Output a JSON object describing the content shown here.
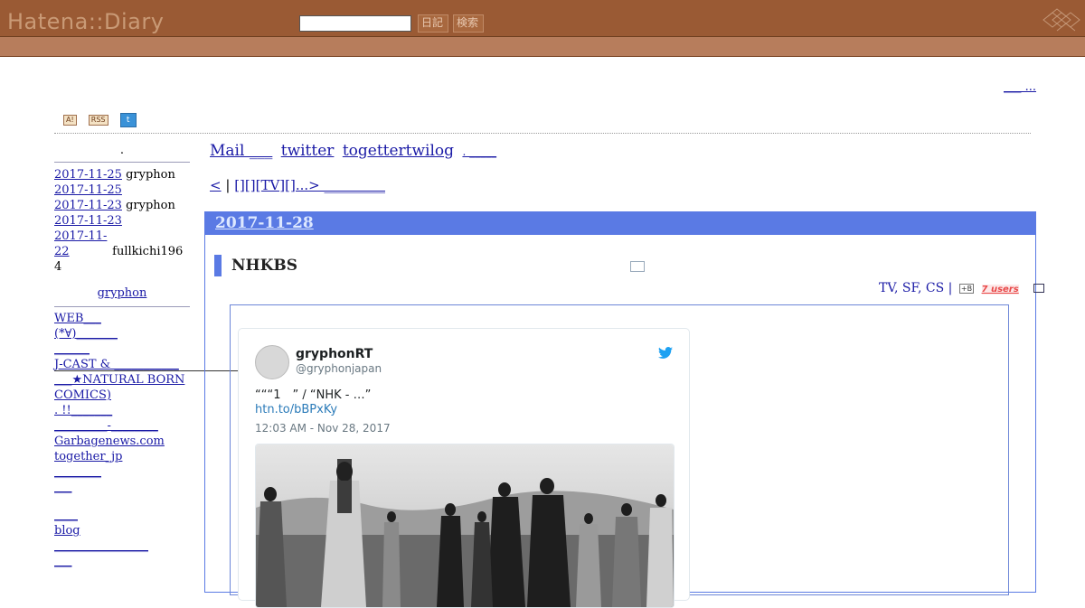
{
  "header": {
    "logo": "Hatena::Diary",
    "search_placeholder": "",
    "diary_button": "日記",
    "search_button": "検索"
  },
  "top_right_link": "___ ...",
  "badges": [
    "A!",
    "RSS"
  ],
  "sidebar": {
    "title": ".",
    "recent": [
      {
        "date": "2017-11-25",
        "user": "gryphon"
      },
      {
        "date": "2017-11-25",
        "user": ""
      },
      {
        "date": "2017-11-23",
        "user": "gryphon"
      },
      {
        "date": "2017-11-23",
        "user": ""
      },
      {
        "date": "2017-11-22",
        "user": "fullkichi1964"
      }
    ],
    "keyword_title": "gryphon",
    "links": [
      "WEB___",
      "(*∀)_______",
      "______",
      "J-CAST & ___________",
      "___★NATURAL BORN COMICS)",
      ". !!_______",
      "_________-________",
      "Garbagenews.com",
      "together_jp",
      "________",
      "___",
      "____",
      "blog",
      "________________",
      "___"
    ]
  },
  "nav": {
    "links": [
      "Mail ___",
      "twitter",
      "togettertwilog",
      ". _____"
    ]
  },
  "pager": {
    "prev": "<",
    "sep": "|",
    "next": "[][][TV][]...> _________"
  },
  "entry": {
    "date": "2017-11-28",
    "title": "NHKBS",
    "categories": "TV, SF, CS |",
    "bookmark_icon": "+B",
    "bookmark_users": "7 users"
  },
  "tweet": {
    "name": "gryphonRT",
    "handle": "@gryphonjapan",
    "text": "“““1　” / “NHK - …”",
    "link": "htn.to/bBPxKy",
    "time": "12:03 AM - Nov 28, 2017"
  },
  "colors": {
    "header_brown": "#9a5a34",
    "subbar_brown": "#b77d5c",
    "day_blue": "#5a7ae4",
    "link_blue": "#1a1aa6"
  }
}
